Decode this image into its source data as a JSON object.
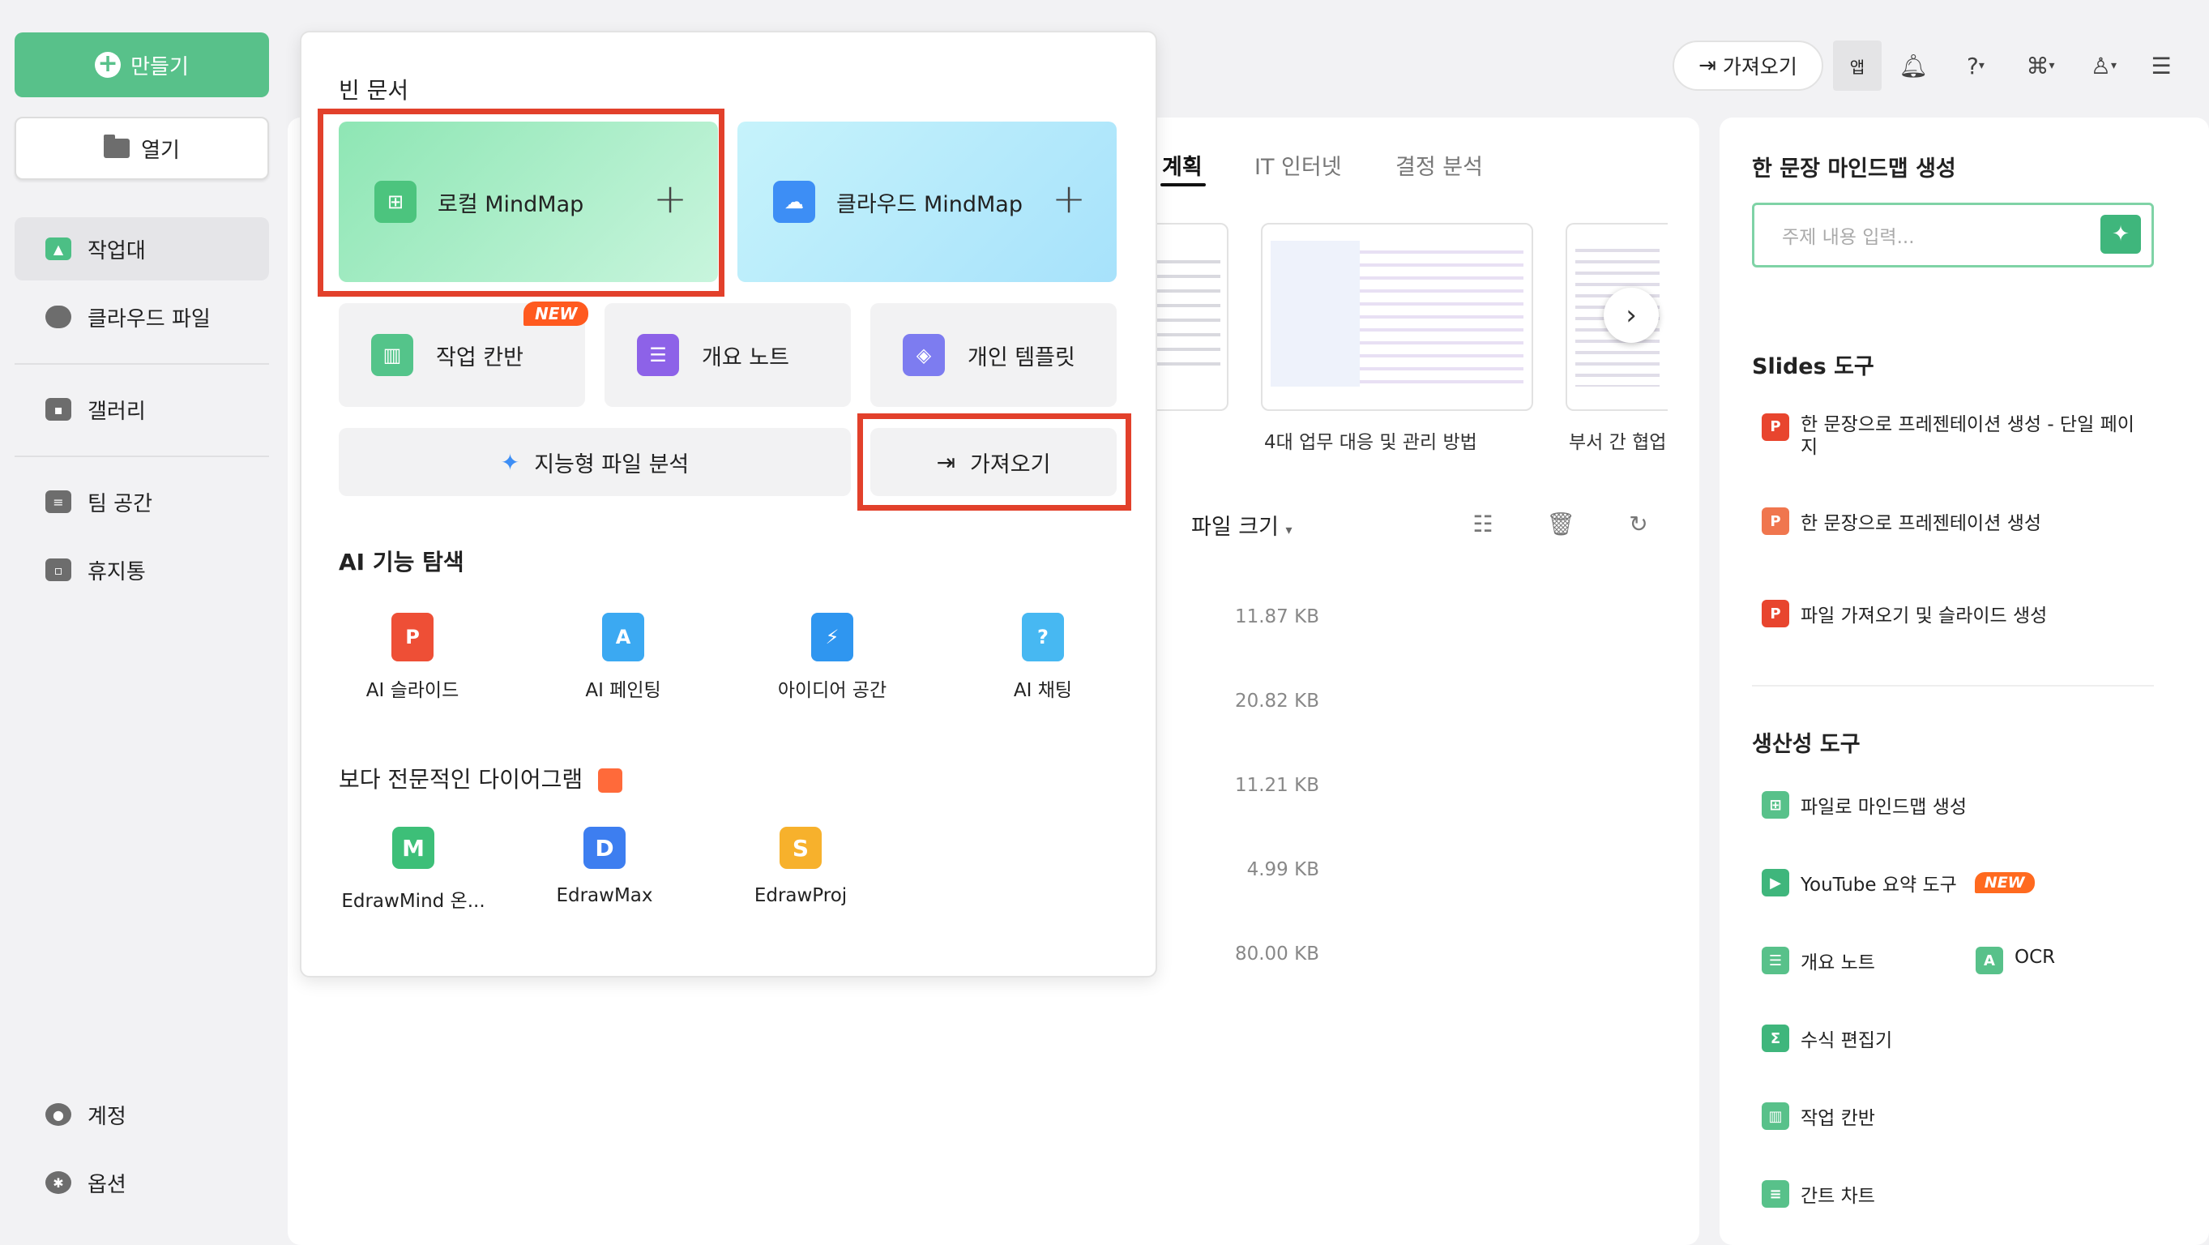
{
  "sidebar": {
    "create_label": "만들기",
    "open_label": "열기",
    "items": [
      {
        "label": "작업대"
      },
      {
        "label": "클라우드 파일"
      },
      {
        "label": "갤러리"
      },
      {
        "label": "팀 공간"
      },
      {
        "label": "휴지통"
      }
    ],
    "account_label": "계정",
    "options_label": "옵션"
  },
  "topbar": {
    "import_label": "가져오기",
    "app_label": "앱",
    "icons": [
      "bell-icon",
      "help-icon",
      "apps-grid-icon",
      "theme-shirt-icon",
      "collapse-panel-icon"
    ]
  },
  "tabs": [
    {
      "label": "계획",
      "active": true
    },
    {
      "label": "IT 인터넷",
      "active": false
    },
    {
      "label": "결정 분석",
      "active": false
    }
  ],
  "templates": [
    {
      "label": "4대 업무 대응 및 관리 방법"
    },
    {
      "label": "부서 간 협업"
    }
  ],
  "file_list": {
    "sort_label": "파일 크기",
    "sizes": [
      "11.87 KB",
      "20.82 KB",
      "11.21 KB",
      "4.99 KB",
      "80.00 KB"
    ]
  },
  "popup": {
    "blank_title": "빈 문서",
    "local_mindmap": "로컬 MindMap",
    "cloud_mindmap": "클라우드 MindMap",
    "kanban": "작업 칸반",
    "new_badge": "NEW",
    "outline": "개요 노트",
    "personal_template": "개인 템플릿",
    "smart_analysis": "지능형 파일 분석",
    "import": "가져오기",
    "ai_title": "AI 기능 탐색",
    "ai_items": [
      {
        "label": "AI 슬라이드"
      },
      {
        "label": "AI 페인팅"
      },
      {
        "label": "아이디어 공간"
      },
      {
        "label": "AI 채팅"
      }
    ],
    "pro_title": "보다 전문적인 다이어그램",
    "pro_items": [
      {
        "label": "EdrawMind 온..."
      },
      {
        "label": "EdrawMax"
      },
      {
        "label": "EdrawProj"
      }
    ]
  },
  "right_panel": {
    "one_sentence_title": "한 문장 마인드맵 생성",
    "input_placeholder": "주제 내용 입력...",
    "slides_title": "Slides 도구",
    "slides_items": [
      {
        "label": "한 문장으로 프레젠테이션 생성 - 단일 페이지"
      },
      {
        "label": "한 문장으로 프레젠테이션 생성"
      },
      {
        "label": "파일 가져오기 및 슬라이드 생성"
      }
    ],
    "productivity_title": "생산성 도구",
    "productivity_items": [
      {
        "label": "파일로 마인드맵 생성"
      },
      {
        "label": "YouTube 요약 도구"
      },
      {
        "label": "개요 노트"
      },
      {
        "label": "OCR"
      },
      {
        "label": "수식 편집기"
      },
      {
        "label": "작업 칸반"
      },
      {
        "label": "간트 차트"
      }
    ],
    "new_badge": "NEW"
  },
  "colors": {
    "accent_green": "#58c18a",
    "highlight_red": "#e2402b",
    "new_badge": "#ff6a1f"
  }
}
